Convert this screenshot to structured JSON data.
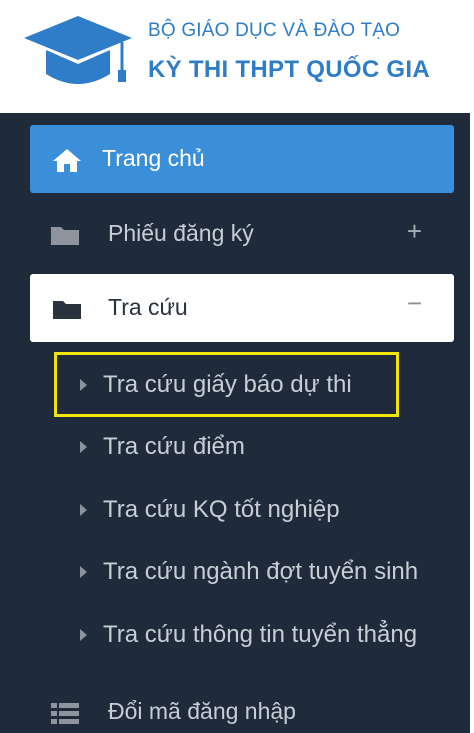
{
  "header": {
    "ministry": "BỘ GIÁO DỤC VÀ ĐÀO TẠO",
    "exam_title": "KỲ THI THPT QUỐC GIA",
    "logo_icon": "graduation-cap-icon"
  },
  "sidebar": {
    "home": {
      "label": "Trang chủ",
      "icon": "home-icon"
    },
    "items": [
      {
        "label": "Phiếu đăng ký",
        "icon": "folder-icon",
        "toggle": "+"
      },
      {
        "label": "Tra cứu",
        "icon": "folder-open-icon",
        "toggle": "−"
      }
    ],
    "submenu": [
      {
        "label": "Tra cứu giấy báo dự thi"
      },
      {
        "label": "Tra cứu điểm"
      },
      {
        "label": "Tra cứu KQ tốt nghiệp"
      },
      {
        "label": "Tra cứu ngành đợt tuyển sinh"
      },
      {
        "label": "Tra cứu thông tin tuyển thẳng"
      }
    ],
    "bottom": {
      "label": "Đổi mã đăng nhập",
      "icon": "list-icon"
    }
  },
  "colors": {
    "brand_blue": "#2f7dc8",
    "active_blue": "#3a8fd8",
    "sidebar_bg": "#1f2b3a",
    "highlight": "#f2e600"
  }
}
